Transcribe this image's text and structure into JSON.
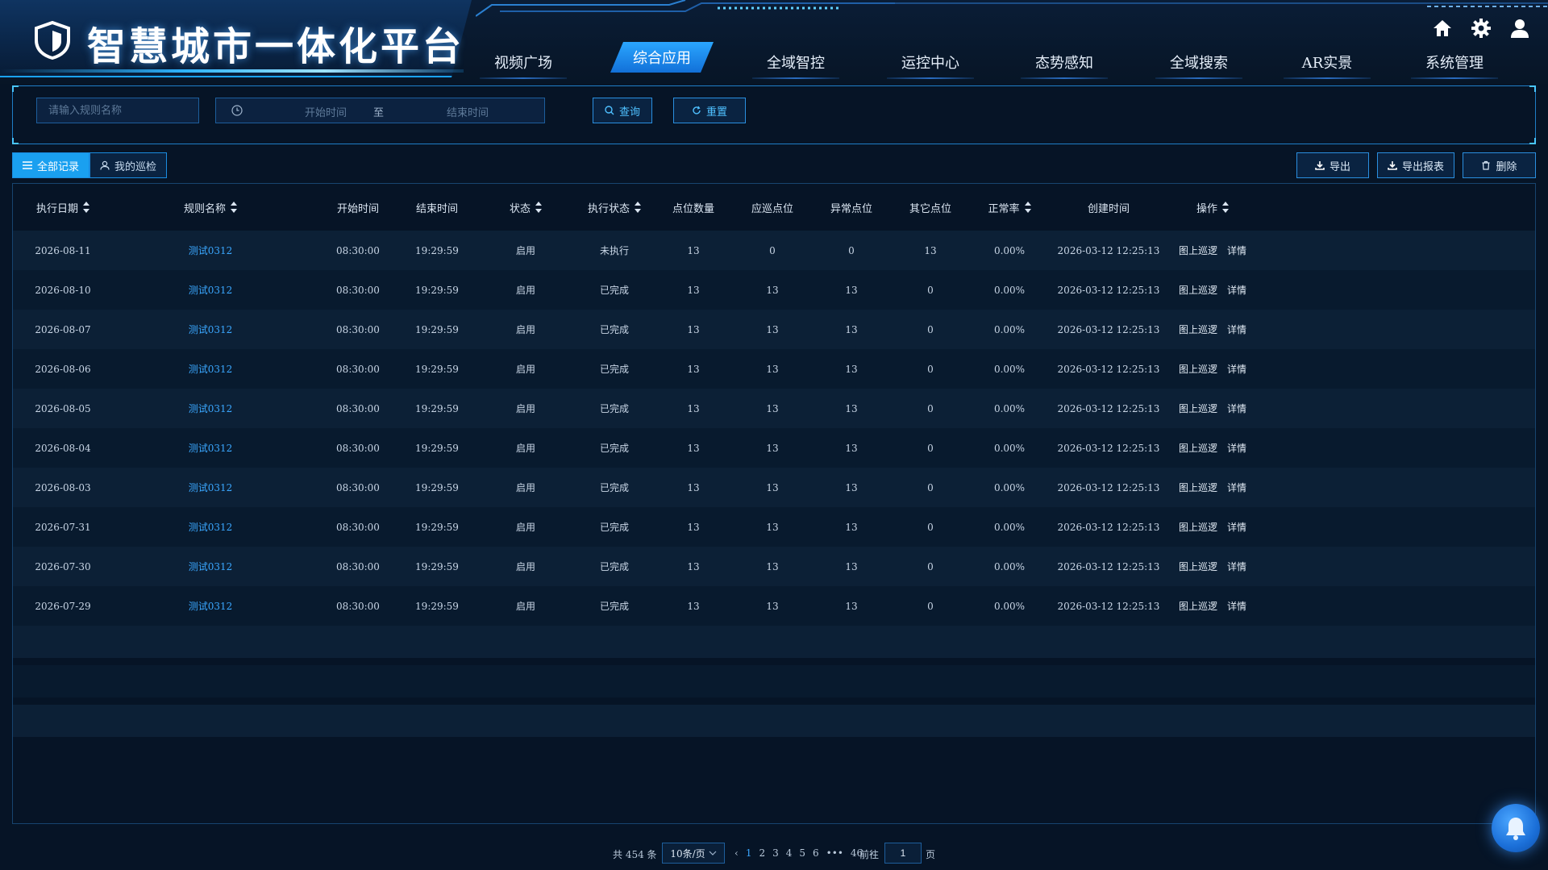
{
  "app": {
    "title": "智慧城市一体化平台"
  },
  "nav": [
    {
      "label": "视频广场",
      "active": false
    },
    {
      "label": "综合应用",
      "active": true
    },
    {
      "label": "全域智控",
      "active": false
    },
    {
      "label": "运控中心",
      "active": false
    },
    {
      "label": "态势感知",
      "active": false
    },
    {
      "label": "全域搜索",
      "active": false
    },
    {
      "label": "AR实景",
      "active": false
    },
    {
      "label": "系统管理",
      "active": false
    }
  ],
  "top_icons": [
    "home-icon",
    "gear-icon",
    "user-icon"
  ],
  "filter": {
    "rule_placeholder": "请输入规则名称",
    "rule_value": "",
    "start_placeholder": "开始时间",
    "range_separator": "至",
    "end_placeholder": "结束时间",
    "query_label": "查询",
    "reset_label": "重置"
  },
  "tabs": [
    {
      "label": "全部记录",
      "active": true,
      "icon": "list-icon"
    },
    {
      "label": "我的巡检",
      "active": false,
      "icon": "user-icon"
    }
  ],
  "toolbar": {
    "export_label": "导出",
    "export_report_label": "导出报表",
    "delete_label": "删除"
  },
  "table": {
    "columns": [
      "执行日期",
      "规则名称",
      "开始时间",
      "结束时间",
      "状态",
      "执行状态",
      "点位数量",
      "应巡点位",
      "异常点位",
      "其它点位",
      "正常率",
      "创建时间",
      "操作"
    ],
    "sortable": [
      true,
      true,
      false,
      false,
      true,
      true,
      false,
      false,
      false,
      false,
      true,
      false,
      true
    ],
    "op_labels": [
      "图上巡逻",
      "详情"
    ],
    "rows": [
      [
        "2026-08-11",
        "测试0312",
        "08:30:00",
        "19:29:59",
        "启用",
        "未执行",
        "13",
        "0",
        "0",
        "13",
        "0.00%",
        "2026-03-12 12:25:13"
      ],
      [
        "2026-08-10",
        "测试0312",
        "08:30:00",
        "19:29:59",
        "启用",
        "已完成",
        "13",
        "13",
        "13",
        "0",
        "0.00%",
        "2026-03-12 12:25:13"
      ],
      [
        "2026-08-07",
        "测试0312",
        "08:30:00",
        "19:29:59",
        "启用",
        "已完成",
        "13",
        "13",
        "13",
        "0",
        "0.00%",
        "2026-03-12 12:25:13"
      ],
      [
        "2026-08-06",
        "测试0312",
        "08:30:00",
        "19:29:59",
        "启用",
        "已完成",
        "13",
        "13",
        "13",
        "0",
        "0.00%",
        "2026-03-12 12:25:13"
      ],
      [
        "2026-08-05",
        "测试0312",
        "08:30:00",
        "19:29:59",
        "启用",
        "已完成",
        "13",
        "13",
        "13",
        "0",
        "0.00%",
        "2026-03-12 12:25:13"
      ],
      [
        "2026-08-04",
        "测试0312",
        "08:30:00",
        "19:29:59",
        "启用",
        "已完成",
        "13",
        "13",
        "13",
        "0",
        "0.00%",
        "2026-03-12 12:25:13"
      ],
      [
        "2026-08-03",
        "测试0312",
        "08:30:00",
        "19:29:59",
        "启用",
        "已完成",
        "13",
        "13",
        "13",
        "0",
        "0.00%",
        "2026-03-12 12:25:13"
      ],
      [
        "2026-07-31",
        "测试0312",
        "08:30:00",
        "19:29:59",
        "启用",
        "已完成",
        "13",
        "13",
        "13",
        "0",
        "0.00%",
        "2026-03-12 12:25:13"
      ],
      [
        "2026-07-30",
        "测试0312",
        "08:30:00",
        "19:29:59",
        "启用",
        "已完成",
        "13",
        "13",
        "13",
        "0",
        "0.00%",
        "2026-03-12 12:25:13"
      ],
      [
        "2026-07-29",
        "测试0312",
        "08:30:00",
        "19:29:59",
        "启用",
        "已完成",
        "13",
        "13",
        "13",
        "0",
        "0.00%",
        "2026-03-12 12:25:13"
      ]
    ]
  },
  "pagination": {
    "total_text": "共 454 条",
    "page_size": "10条/页",
    "pages": [
      "1",
      "2",
      "3",
      "4",
      "5",
      "6",
      "•••",
      "46"
    ],
    "current": "1",
    "goto_label": "前往",
    "goto_value": "1",
    "page_suffix": "页"
  },
  "colors": {
    "accent": "#1aa0f0",
    "link": "#3aa7ff",
    "background": "#061426"
  }
}
